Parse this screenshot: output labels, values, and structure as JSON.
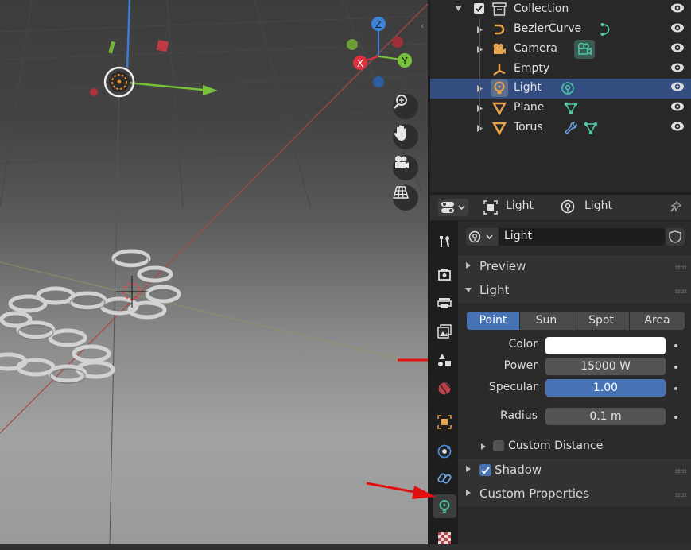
{
  "outliner": {
    "items": [
      {
        "label": "Collection"
      },
      {
        "label": "BezierCurve"
      },
      {
        "label": "Camera"
      },
      {
        "label": "Empty"
      },
      {
        "label": "Light"
      },
      {
        "label": "Plane"
      },
      {
        "label": "Torus"
      }
    ]
  },
  "props_header": {
    "context_label": "Light",
    "data_label": "Light"
  },
  "datablock": {
    "name": "Light"
  },
  "panels": {
    "preview": "Preview",
    "light": "Light",
    "custom_distance": "Custom Distance",
    "shadow": "Shadow",
    "custom_properties": "Custom Properties"
  },
  "light_types": [
    "Point",
    "Sun",
    "Spot",
    "Area"
  ],
  "light_type_selected": "Point",
  "fields": {
    "color_label": "Color",
    "power_label": "Power",
    "power_value": "15000 W",
    "specular_label": "Specular",
    "specular_value": "1.00",
    "radius_label": "Radius",
    "radius_value": "0.1 m"
  },
  "gizmo_axes": {
    "x": "X",
    "y": "Y",
    "z": "Z"
  },
  "colors": {
    "selection": "#334d80",
    "accent_blue": "#4772b3",
    "light_icon": "#e8a24a",
    "arrow_red": "#e01010"
  }
}
